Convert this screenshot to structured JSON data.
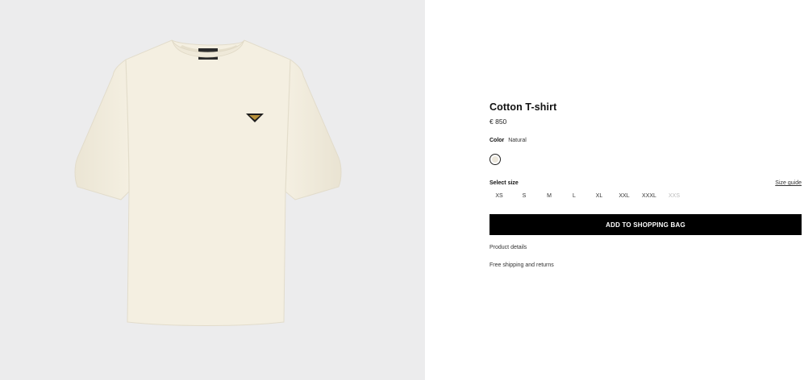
{
  "product": {
    "name": "Cotton T-shirt",
    "price": "€ 850",
    "color_label": "Color",
    "color_value": "Natural",
    "swatch_color": "#ece7db",
    "tshirt_color": "#f3eedf"
  },
  "sizes": {
    "label": "Select size",
    "guide": "Size guide",
    "options": [
      {
        "label": "XS",
        "available": true
      },
      {
        "label": "S",
        "available": true
      },
      {
        "label": "M",
        "available": true
      },
      {
        "label": "L",
        "available": true
      },
      {
        "label": "XL",
        "available": true
      },
      {
        "label": "XXL",
        "available": true
      },
      {
        "label": "XXXL",
        "available": true
      },
      {
        "label": "XXS",
        "available": false
      }
    ]
  },
  "actions": {
    "add_to_bag": "ADD TO SHOPPING BAG",
    "product_details": "Product details",
    "shipping": "Free shipping and returns"
  }
}
